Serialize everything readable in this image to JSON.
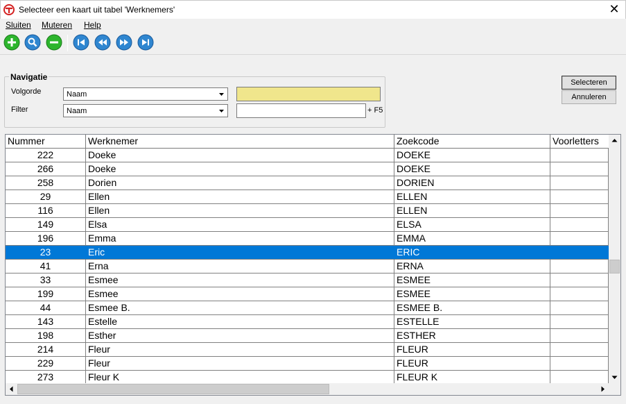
{
  "window": {
    "title": "Selecteer een kaart uit tabel 'Werknemers'",
    "close_label": "✕"
  },
  "menu": [
    {
      "label": "Sluiten"
    },
    {
      "label": "Muteren"
    },
    {
      "label": "Help"
    }
  ],
  "toolbar": [
    {
      "icon": "plus-icon",
      "color": "#2db52d"
    },
    {
      "icon": "search-icon",
      "color": "#2f86d0"
    },
    {
      "icon": "minus-icon",
      "color": "#2db52d"
    },
    {
      "icon": "first-record-icon",
      "color": "#2f86d0"
    },
    {
      "icon": "previous-record-icon",
      "color": "#2f86d0"
    },
    {
      "icon": "next-record-icon",
      "color": "#2f86d0"
    },
    {
      "icon": "last-record-icon",
      "color": "#2f86d0"
    }
  ],
  "navigation": {
    "legend": "Navigatie",
    "volgorde_label": "Volgorde",
    "volgorde_value": "Naam",
    "filter_label": "Filter",
    "filter_value": "Naam",
    "search_value": "",
    "filter_text_value": "",
    "f5_hint": "+ F5",
    "search_bg": "#f0e68c"
  },
  "buttons": {
    "select": "Selecteren",
    "cancel": "Annuleren"
  },
  "grid": {
    "columns": [
      "Nummer",
      "Werknemer",
      "Zoekcode",
      "Voorletters"
    ],
    "selected_row": 7,
    "selection_color": "#0078d7",
    "rows": [
      [
        "222",
        "Doeke",
        "DOEKE",
        ""
      ],
      [
        "266",
        "Doeke",
        "DOEKE",
        ""
      ],
      [
        "258",
        "Dorien",
        "DORIEN",
        ""
      ],
      [
        "29",
        "Ellen",
        "ELLEN",
        ""
      ],
      [
        "116",
        "Ellen",
        "ELLEN",
        ""
      ],
      [
        "149",
        "Elsa",
        "ELSA",
        ""
      ],
      [
        "196",
        "Emma",
        "EMMA",
        ""
      ],
      [
        "23",
        "Eric",
        "ERIC",
        ""
      ],
      [
        "41",
        "Erna",
        "ERNA",
        ""
      ],
      [
        "33",
        "Esmee",
        "ESMEE",
        ""
      ],
      [
        "199",
        "Esmee",
        "ESMEE",
        ""
      ],
      [
        "44",
        "Esmee B.",
        "ESMEE B.",
        ""
      ],
      [
        "143",
        "Estelle",
        "ESTELLE",
        ""
      ],
      [
        "198",
        "Esther",
        "ESTHER",
        ""
      ],
      [
        "214",
        "Fleur",
        "FLEUR",
        ""
      ],
      [
        "229",
        "Fleur",
        "FLEUR",
        ""
      ],
      [
        "273",
        "Fleur K",
        "FLEUR K",
        ""
      ]
    ]
  }
}
